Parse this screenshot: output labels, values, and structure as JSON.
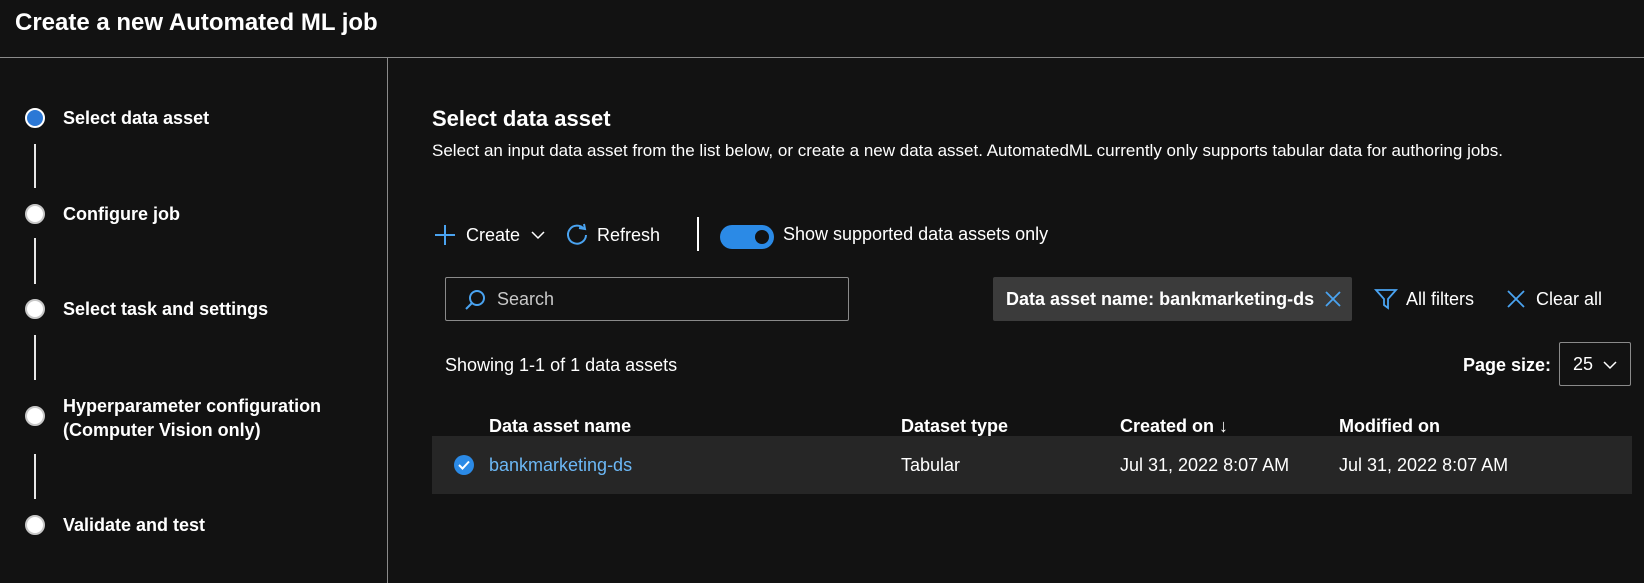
{
  "header": {
    "title": "Create a new Automated ML job"
  },
  "steps": [
    {
      "label": "Select data asset",
      "state": "active"
    },
    {
      "label": "Configure job",
      "state": "inactive"
    },
    {
      "label": "Select task and settings",
      "state": "inactive"
    },
    {
      "label_line1": "Hyperparameter configuration",
      "label_line2": "(Computer Vision only)",
      "state": "inactive"
    },
    {
      "label": "Validate and test",
      "state": "inactive"
    }
  ],
  "main": {
    "title": "Select data asset",
    "description": "Select an input data asset from the list below, or create a new data asset. AutomatedML currently only supports tabular data for authoring jobs."
  },
  "toolbar": {
    "create_label": "Create",
    "create_icon": "plus-icon",
    "refresh_label": "Refresh",
    "refresh_icon": "refresh-icon",
    "toggle_label": "Show supported data assets only",
    "toggle_on": true
  },
  "search": {
    "placeholder": "Search"
  },
  "filters": {
    "chip_label": "Data asset name: bankmarketing-ds",
    "all_filters_label": "All filters",
    "clear_all_label": "Clear all"
  },
  "list": {
    "showing": "Showing 1-1 of 1 data assets",
    "page_size_label": "Page size:",
    "page_size_value": "25"
  },
  "table": {
    "columns": [
      "Data asset name",
      "Dataset type",
      "Created on ↓",
      "Modified on"
    ],
    "rows": [
      {
        "selected": true,
        "name": "bankmarketing-ds",
        "type": "Tabular",
        "created": "Jul 31, 2022 8:07 AM",
        "modified": "Jul 31, 2022 8:07 AM"
      }
    ]
  },
  "colors": {
    "accent": "#2b8ae6",
    "link": "#6cb8f6",
    "background": "#121212"
  }
}
